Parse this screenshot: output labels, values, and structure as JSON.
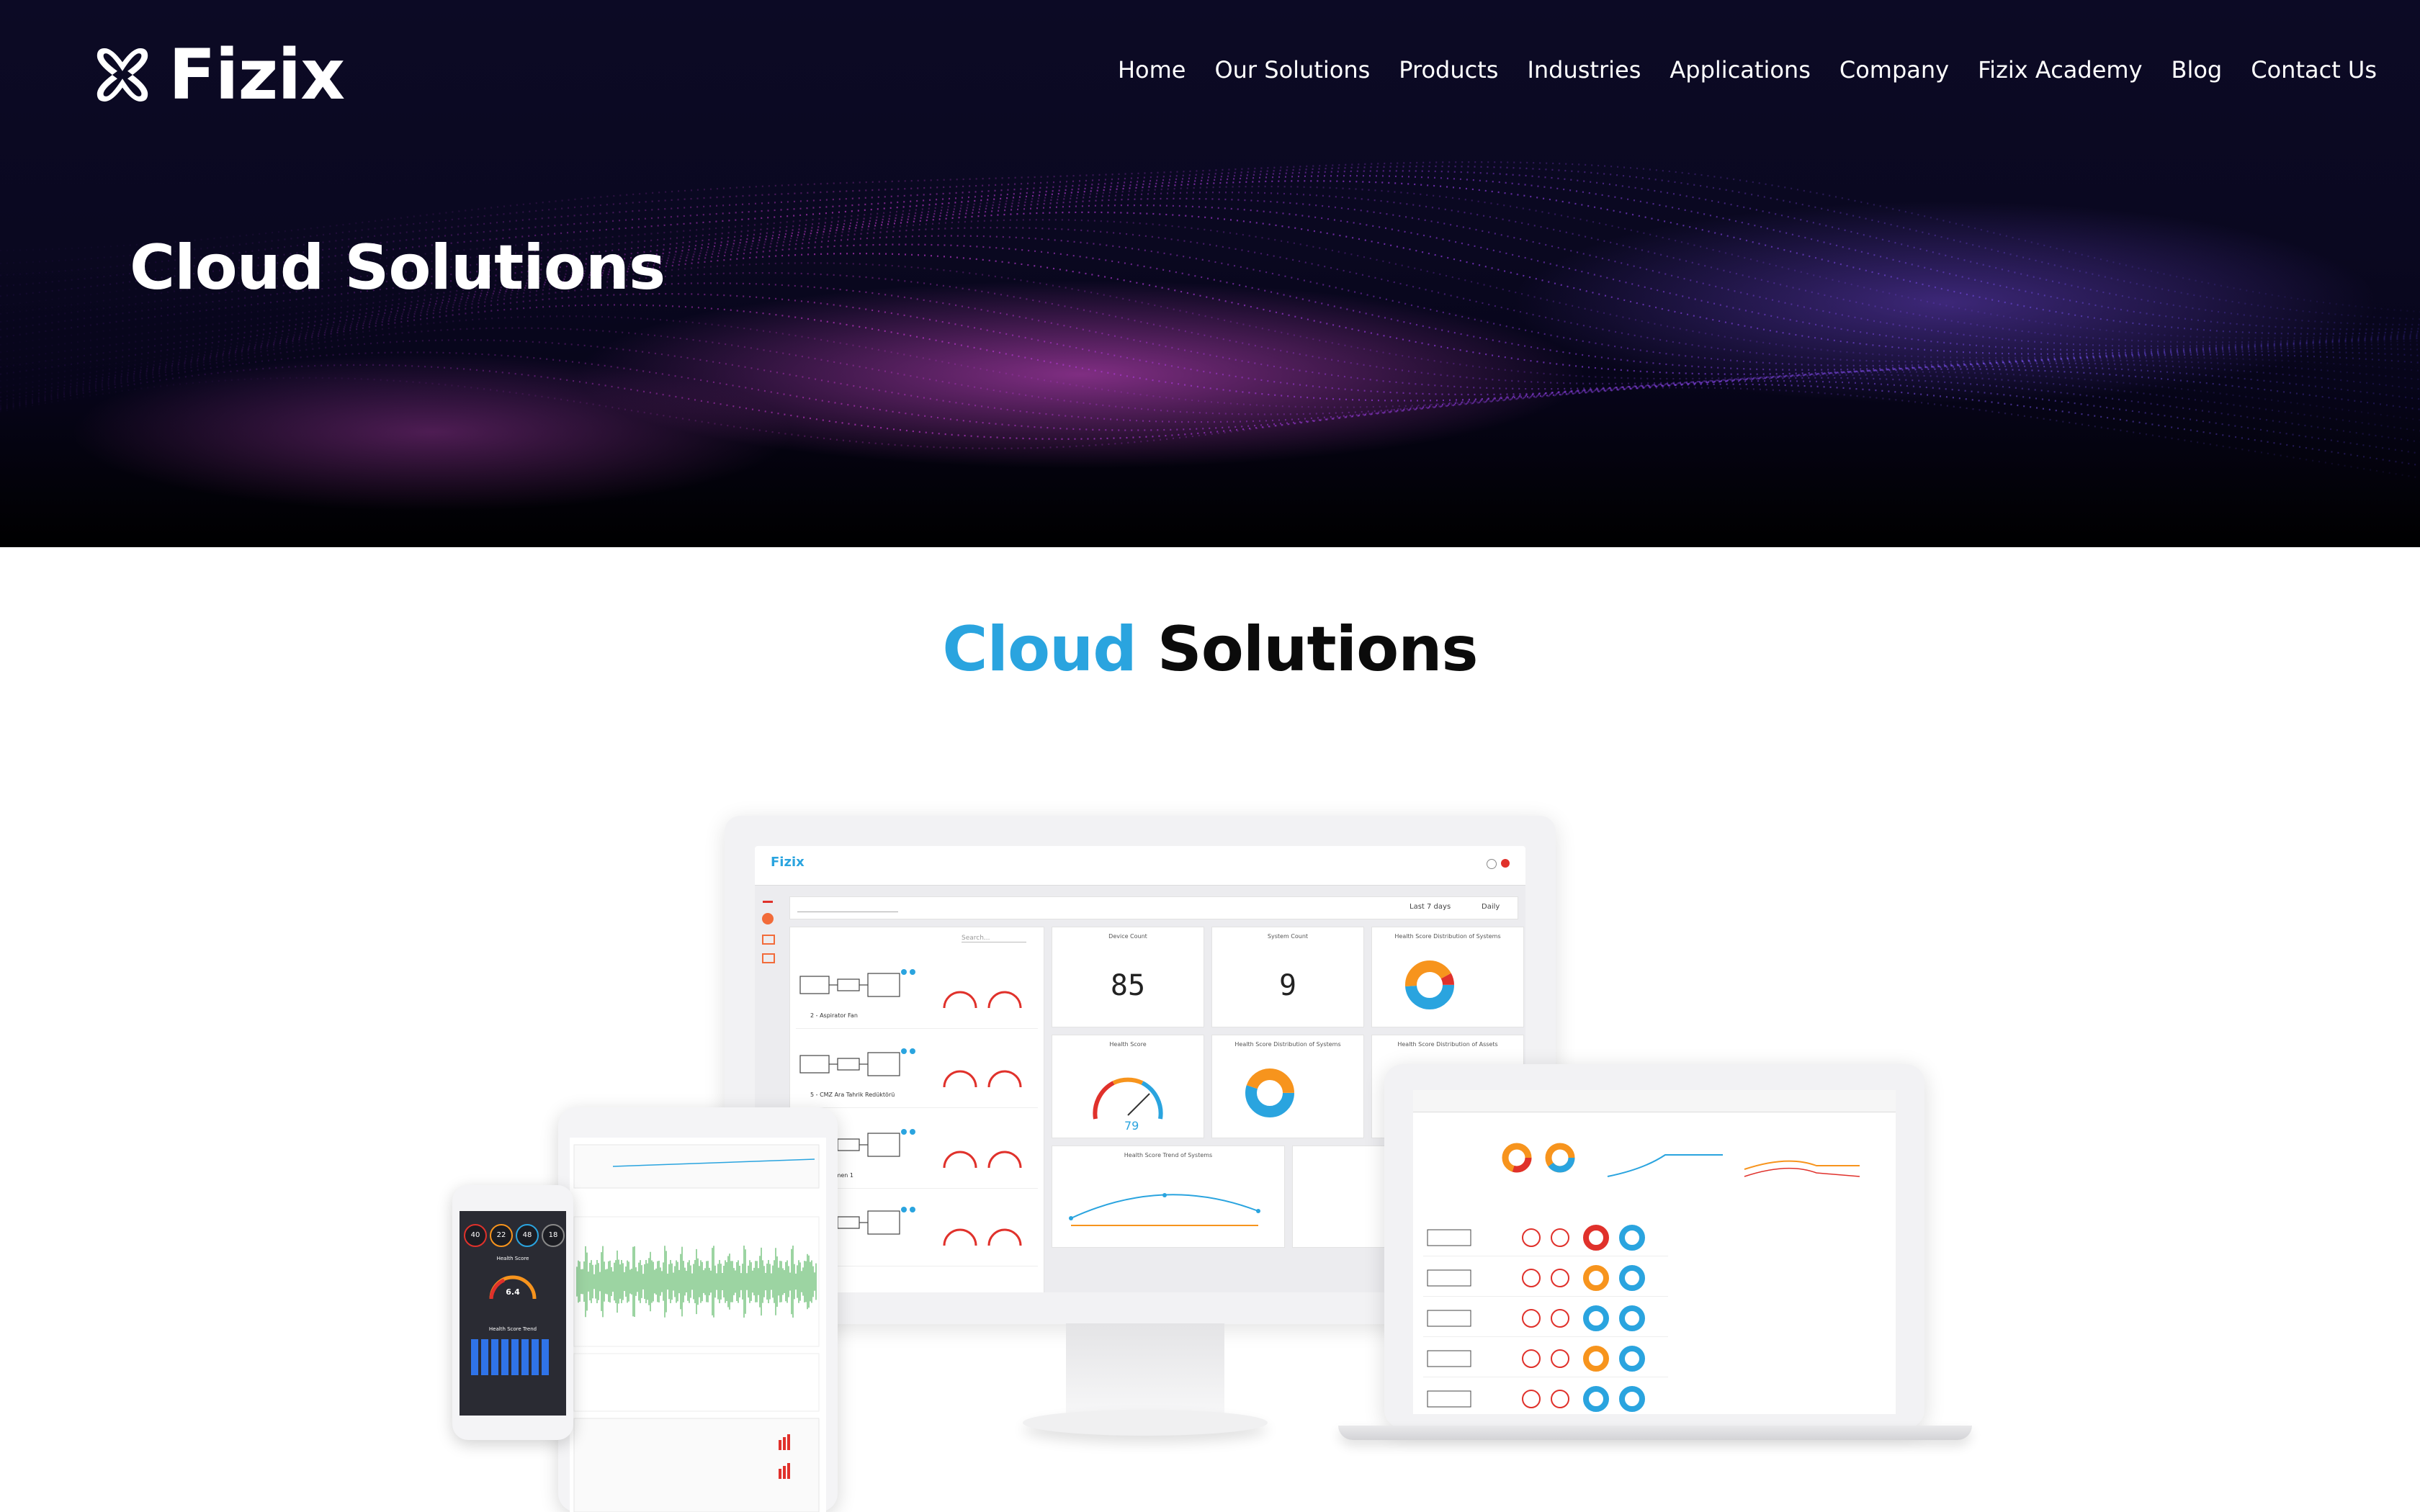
{
  "brand": {
    "name": "Fizix"
  },
  "nav": {
    "items": [
      {
        "label": "Home"
      },
      {
        "label": "Our Solutions"
      },
      {
        "label": "Products"
      },
      {
        "label": "Industries"
      },
      {
        "label": "Applications"
      },
      {
        "label": "Company"
      },
      {
        "label": "Fizix Academy"
      },
      {
        "label": "Blog"
      },
      {
        "label": "Contact Us"
      }
    ]
  },
  "hero": {
    "title": "Cloud Solutions"
  },
  "section": {
    "title_accent": "Cloud",
    "title_rest": "Solutions"
  },
  "dashboard": {
    "brand": "Fizix",
    "filter_range": "Last 7 days",
    "filter_interval": "Daily",
    "device_count_label": "Device Count",
    "device_count": "85",
    "system_count_label": "System Count",
    "system_count": "9",
    "health_score_label": "Health Score",
    "health_score": "79",
    "dist_systems_label": "Health Score Distribution of Systems",
    "dist_assets_label": "Health Score Distribution of Assets",
    "trend_label": "Health Score Trend of Systems",
    "search_placeholder": "Search...",
    "assets": [
      {
        "name": "2 - Aspirator Fan"
      },
      {
        "name": "5 - CMZ Ara Tahrik Redüktörü"
      },
      {
        "name": "1 - Değirmen 1"
      }
    ]
  },
  "phone": {
    "stats": [
      "40",
      "22",
      "48",
      "18"
    ],
    "health_score": "6.4",
    "health_score_label": "Health Score",
    "trend_label": "Health Score Trend"
  },
  "colors": {
    "accent": "#2aa4df",
    "orange": "#f7941d",
    "red": "#e0312b",
    "magenta": "#c23ccf",
    "purple": "#6b3fd6"
  }
}
